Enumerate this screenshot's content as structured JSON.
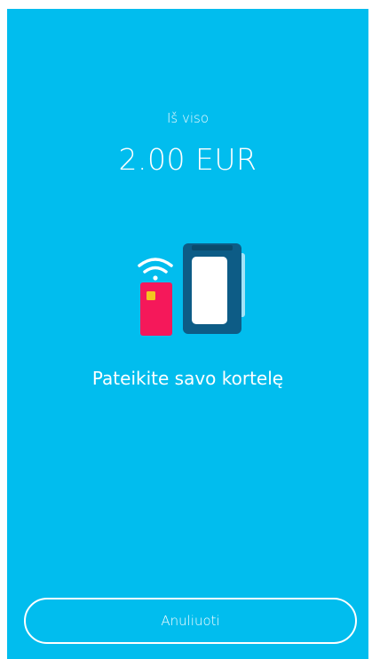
{
  "payment": {
    "total_label": "Iš viso",
    "amount": "2.00 EUR",
    "prompt": "Pateikite savo kortelę"
  },
  "actions": {
    "cancel_label": "Anuliuoti"
  },
  "icons": {
    "illustration": "contactless-card-terminal-icon"
  },
  "colors": {
    "background": "#01bdee",
    "card": "#f5185a",
    "card_chip": "#f3c520",
    "terminal": "#0d5c86"
  }
}
